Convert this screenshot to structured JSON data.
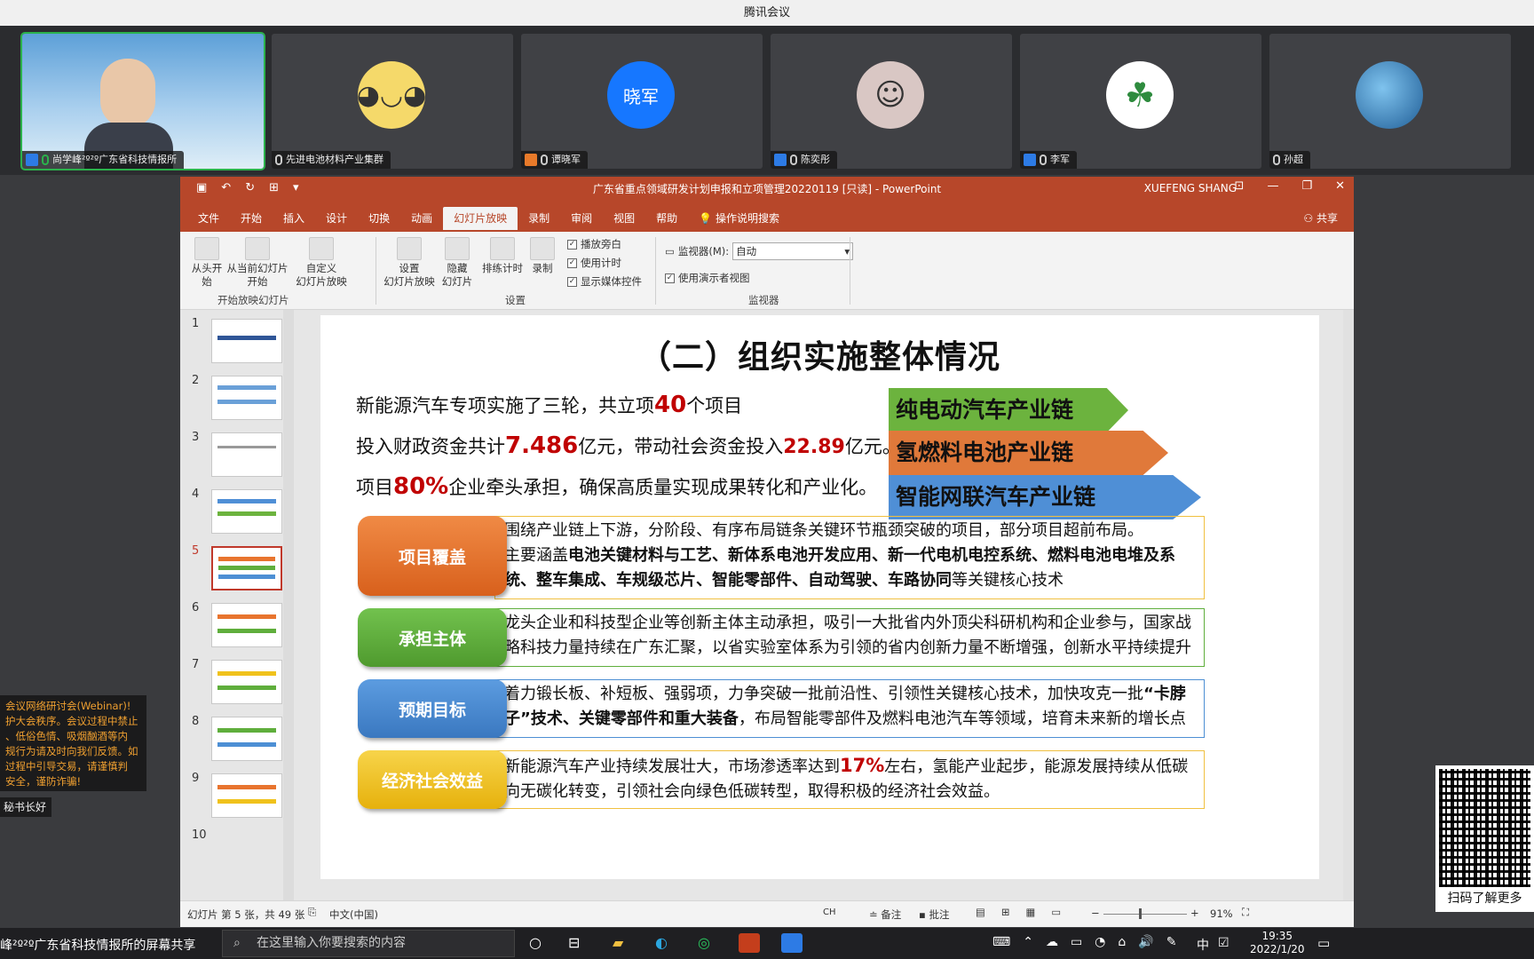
{
  "window": {
    "title": "腾讯会议"
  },
  "participants": [
    {
      "name": "尚学峰²º²º广东省科技情报所",
      "avatar_color": "#6fa8d8"
    },
    {
      "name": "先进电池材料产业集群",
      "avatar_color": "#f5d96a"
    },
    {
      "name": "谭晓军",
      "avatar_text": "晓军",
      "avatar_color": "#1677ff"
    },
    {
      "name": "陈奕彤",
      "avatar_color": "#d9c7c4"
    },
    {
      "name": "李军",
      "avatar_color": "#ffffff"
    },
    {
      "name": "孙超",
      "avatar_color": "#3a87c9"
    }
  ],
  "ppt": {
    "title": "广东省重点领域研发计划申报和立项管理20220119 [只读] - PowerPoint",
    "user": "XUEFENG SHANG",
    "share": "共享",
    "tabs": [
      "文件",
      "开始",
      "插入",
      "设计",
      "切换",
      "动画",
      "幻灯片放映",
      "录制",
      "审阅",
      "视图",
      "帮助",
      "操作说明搜索"
    ],
    "ribbon": {
      "from_start": "从头开始",
      "from_current": "从当前幻灯片\n开始",
      "custom": "自定义\n幻灯片放映",
      "group_start": "开始放映幻灯片",
      "setup": "设置\n幻灯片放映",
      "hide": "隐藏\n幻灯片",
      "rehearse": "排练计时",
      "record": "录制",
      "chk_narration": "播放旁白",
      "chk_timing": "使用计时",
      "chk_media": "显示媒体控件",
      "group_setup": "设置",
      "monitor_label": "监视器(M):",
      "monitor_value": "自动",
      "presenter_view": "使用演示者视图",
      "group_monitor": "监视器"
    },
    "thumb_numbers": [
      "1",
      "2",
      "3",
      "4",
      "5",
      "6",
      "7",
      "8",
      "9",
      "10"
    ],
    "status": {
      "slide_info": "幻灯片 第 5 张，共 49 张",
      "language": "中文(中国)",
      "ime": "CH",
      "notes": "备注",
      "comments": "批注",
      "zoom": "91%"
    }
  },
  "slide": {
    "title": "（二）组织实施整体情况",
    "line1": {
      "pre": "新能源汽车专项实施了三轮，共立项",
      "num": "40",
      "post": "个项目"
    },
    "line2": {
      "pre": "投入财政资金共计",
      "num1": "7.486",
      "mid": "亿元，带动社会资金投入",
      "num2": "22.89",
      "post": "亿元。"
    },
    "line3": {
      "pre": "项目",
      "num": "80%",
      "post": "企业牵头承担，确保高质量实现成果转化和产业化。"
    },
    "chains": [
      {
        "label": "纯电动汽车产业链",
        "color": "#6cb33e"
      },
      {
        "label": "氢燃料电池产业链",
        "color": "#e0793a"
      },
      {
        "label": "智能网联汽车产业链",
        "color": "#4f8fd6"
      }
    ],
    "rows": [
      {
        "label": "项目覆盖",
        "color": "#e8742e",
        "text1": "围绕产业链上下游，分阶段、有序布局链条关键环节瓶颈突破的项目，部分项目超前布局。",
        "text2_pre": "主要涵盖",
        "text2_bold": "电池关键材料与工艺、新体系电池开发应用、新一代电机电控系统、燃料电池电堆及系统、整车集成、车规级芯片、智能零部件、自动驾驶、车路协同",
        "text2_post": "等关键核心技术"
      },
      {
        "label": "承担主体",
        "color": "#5fae3c",
        "text1": "龙头企业和科技型企业等创新主体主动承担，吸引一大批省内外顶尖科研机构和企业参与，国家战略科技力量持续在广东汇聚，以省实验室体系为引领的省内创新力量不断增强，创新水平持续提升"
      },
      {
        "label": "预期目标",
        "color": "#4d8fd4",
        "text1_pre": "着力锻长板、补短板、强弱项，力争突破一批前沿性、引领性关键核心技术，加快攻克一批",
        "text1_bold": "“卡脖子”技术、关键零部件和重大装备",
        "text1_post": "，布局智能零部件及燃料电池汽车等领域，培育未来新的增长点"
      },
      {
        "label": "经济社会效益",
        "color": "#f0c21c",
        "text1_pre": "新能源汽车产业持续发展壮大，市场渗透率达到",
        "text1_num": "17%",
        "text1_post": "左右，氢能产业起步，能源发展持续从低碳向无碳化转变，引领社会向绿色低碳转型，取得积极的经济社会效益。"
      }
    ]
  },
  "notice": {
    "text": "会议网络研讨会(Webinar)!\n护大会秩序。会议过程中禁止\n、低俗色情、吸烟酗酒等内\n规行为请及时向我们反馈。如\n过程中引导交易，请谨慎判\n安全，谨防诈骗!",
    "chip": "秘书长好"
  },
  "qr": {
    "caption": "扫码了解更多"
  },
  "taskbar": {
    "share_label": "峰²º²º广东省科技情报所的屏幕共享",
    "search_placeholder": "在这里输入你要搜索的内容",
    "ime": "中",
    "time": "19:35",
    "date": "2022/1/20"
  }
}
